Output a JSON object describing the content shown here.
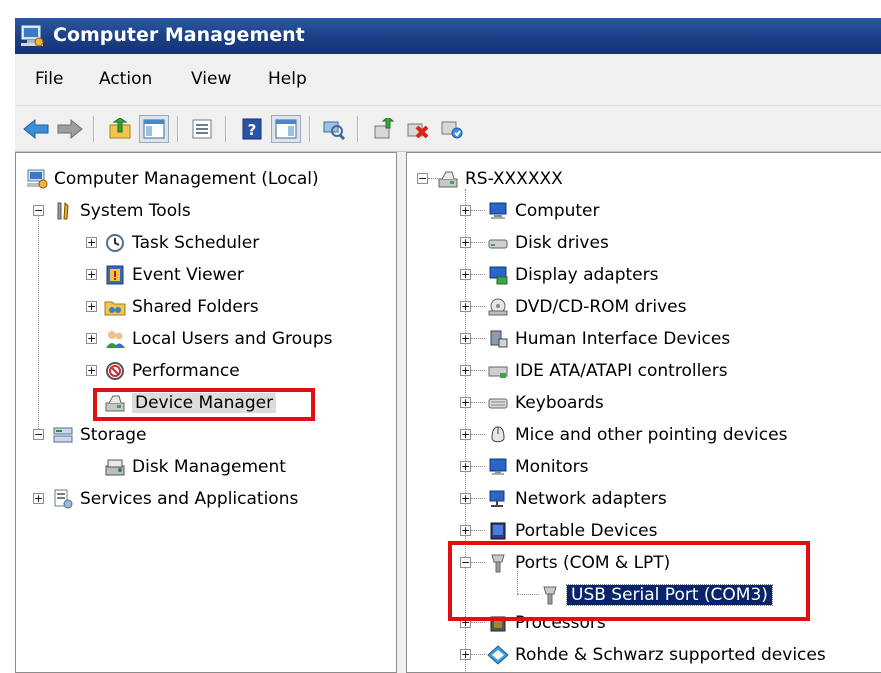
{
  "window": {
    "title": "Computer Management"
  },
  "menu": [
    "File",
    "Action",
    "View",
    "Help"
  ],
  "toolbar": {
    "icons": [
      "back-arrow-icon",
      "forward-arrow-icon",
      "up-folder-icon",
      "show-hide-console-tree-icon",
      "properties-icon",
      "help-icon",
      "show-hide-action-pane-icon",
      "scan-hardware-icon",
      "update-driver-icon",
      "uninstall-icon",
      "enable-device-icon"
    ]
  },
  "left_tree": {
    "root": "Computer Management (Local)",
    "system_tools": "System Tools",
    "task_scheduler": "Task Scheduler",
    "event_viewer": "Event Viewer",
    "shared_folders": "Shared Folders",
    "local_users": "Local Users and Groups",
    "performance": "Performance",
    "device_manager": "Device Manager",
    "storage": "Storage",
    "disk_management": "Disk Management",
    "services": "Services and Applications"
  },
  "right_tree": {
    "root": "RS-XXXXXX",
    "categories": [
      "Computer",
      "Disk drives",
      "Display adapters",
      "DVD/CD-ROM drives",
      "Human Interface Devices",
      "IDE ATA/ATAPI controllers",
      "Keyboards",
      "Mice and other pointing devices",
      "Monitors",
      "Network adapters",
      "Portable Devices",
      "Ports (COM & LPT)",
      "Processors",
      "Rohde & Schwarz supported devices"
    ],
    "ports_child": "USB Serial Port (COM3)"
  },
  "colors": {
    "titlebar": "#1b3f86",
    "highlight_box": "#e01010",
    "selection": "#0a246a"
  }
}
